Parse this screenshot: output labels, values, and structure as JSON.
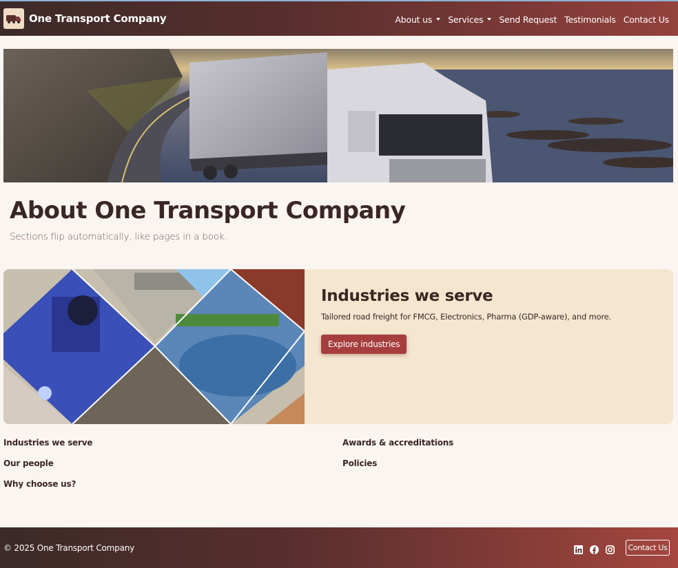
{
  "brand": {
    "name": "One Transport Company"
  },
  "nav": {
    "items": [
      {
        "label": "About us",
        "dropdown": true
      },
      {
        "label": "Services",
        "dropdown": true
      },
      {
        "label": "Send Request",
        "dropdown": false
      },
      {
        "label": "Testimonials",
        "dropdown": false
      },
      {
        "label": "Contact Us",
        "dropdown": false
      }
    ]
  },
  "page": {
    "title": "About One Transport Company",
    "subtitle": "Sections flip automatically, like pages in a book."
  },
  "card": {
    "title": "Industries we serve",
    "text": "Tailored road freight for FMCG, Electronics, Pharma (GDP-aware), and more.",
    "button": "Explore industries"
  },
  "sections": [
    "Industries we serve",
    "Awards & accreditations",
    "Our people",
    "Policies",
    "Why choose us?"
  ],
  "footer": {
    "copyright": "© 2025 One Transport Company",
    "contact_button": "Contact Us",
    "social": [
      "linkedin-icon",
      "facebook-icon",
      "instagram-icon"
    ]
  },
  "colors": {
    "accent": "#a63e3e",
    "header_start": "#3b2a28",
    "header_end": "#94413d",
    "card_background": "#f5e6d0",
    "page_background": "#fbf5f1"
  }
}
